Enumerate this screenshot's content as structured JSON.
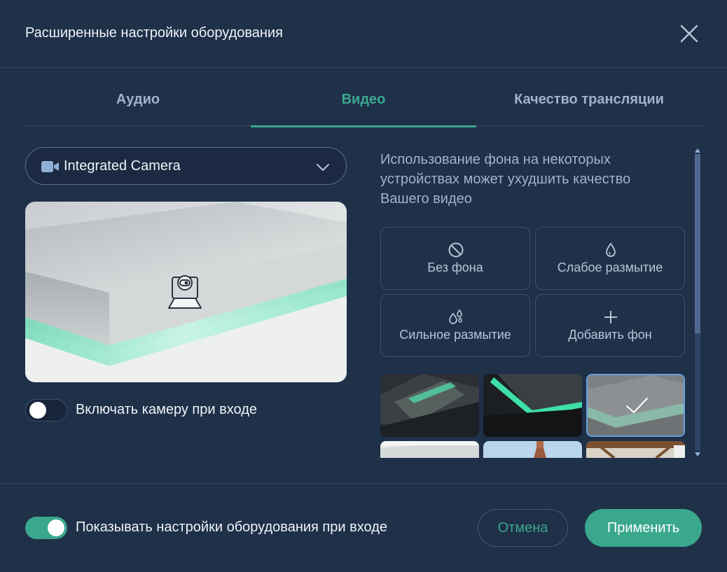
{
  "dialog": {
    "title": "Расширенные настройки оборудования"
  },
  "tabs": [
    {
      "label": "Аудио",
      "active": false
    },
    {
      "label": "Видео",
      "active": true
    },
    {
      "label": "Качество трансляции",
      "active": false
    }
  ],
  "camera_select": {
    "value": "Integrated Camera",
    "icon": "video-camera-icon"
  },
  "preview": {
    "status_icon": "camera-off-icon"
  },
  "camera_on_entry": {
    "label": "Включать камеру при входе",
    "enabled": false
  },
  "background": {
    "info": "Использование фона на некоторых устройствах может ухудшить качество Вашего видео",
    "options": [
      {
        "label": "Без фона",
        "icon": "no-background-icon"
      },
      {
        "label": "Слабое размытие",
        "icon": "drop-icon"
      },
      {
        "label": "Сильное размытие",
        "icon": "drops-icon"
      },
      {
        "label": "Добавить фон",
        "icon": "plus-icon"
      }
    ],
    "selected_thumbnail": 3
  },
  "footer": {
    "show_settings_label": "Показывать настройки оборудования при входе",
    "show_settings_enabled": true,
    "cancel_label": "Отмена",
    "apply_label": "Применить"
  },
  "colors": {
    "background": "#1f3049",
    "accent": "#3aa88d",
    "muted_text": "#9fb3cc"
  }
}
